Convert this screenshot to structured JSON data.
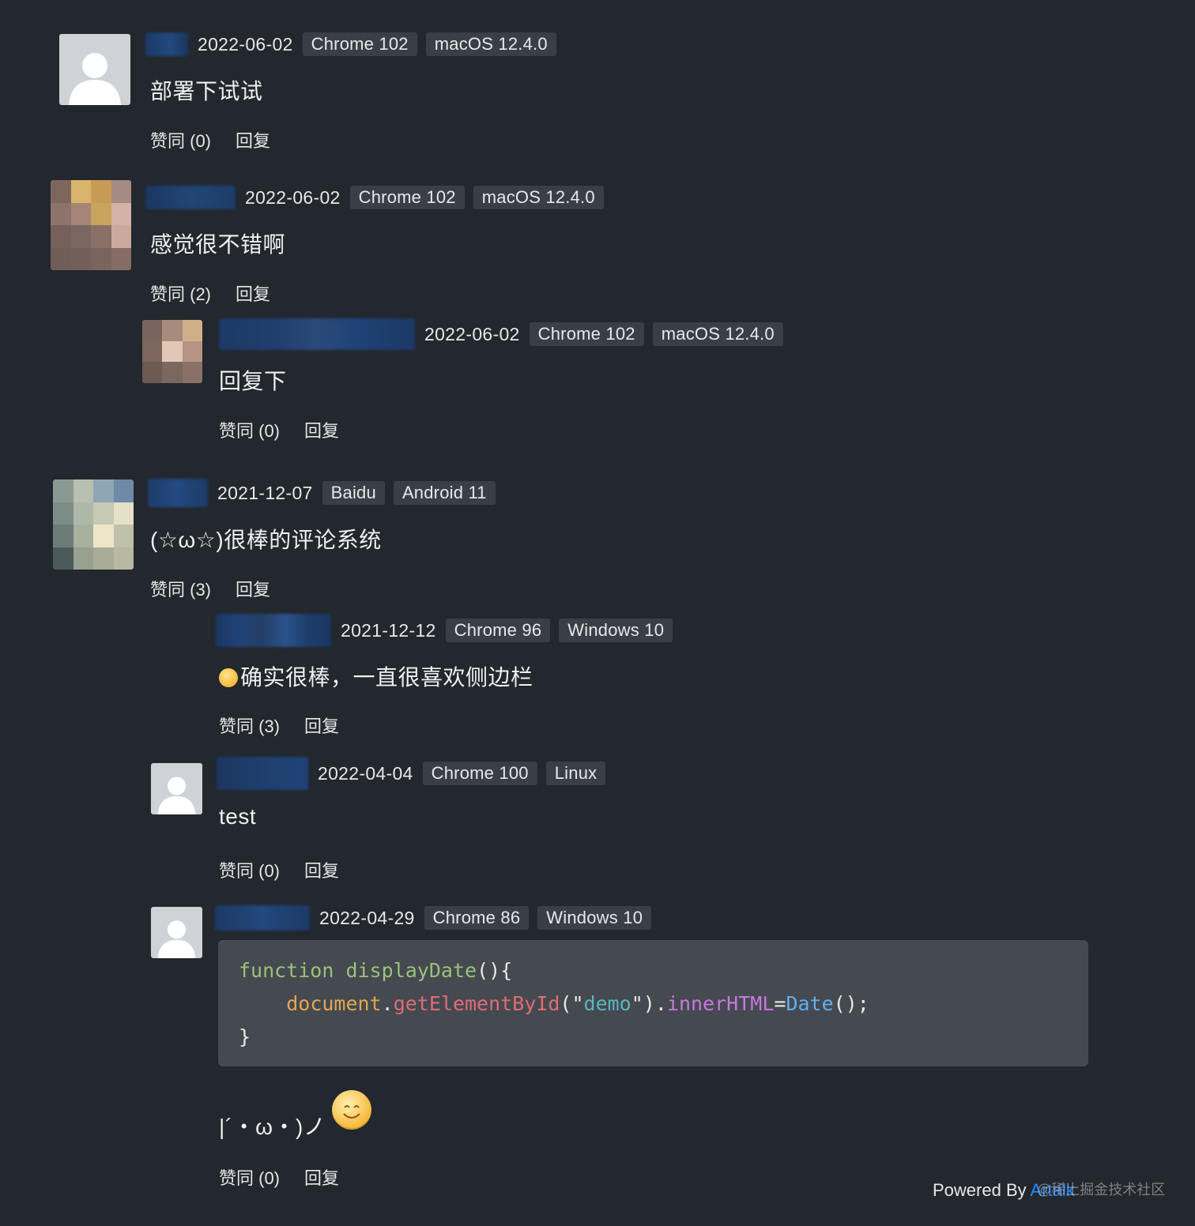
{
  "comments": [
    {
      "date": "2022-06-02",
      "browser": "Chrome 102",
      "os": "macOS 12.4.0",
      "content": "部署下试试",
      "like": "赞同 (0)",
      "reply": "回复"
    },
    {
      "date": "2022-06-02",
      "browser": "Chrome 102",
      "os": "macOS 12.4.0",
      "content": "感觉很不错啊",
      "like": "赞同 (2)",
      "reply": "回复"
    },
    {
      "date": "2022-06-02",
      "browser": "Chrome 102",
      "os": "macOS 12.4.0",
      "content": "回复下",
      "like": "赞同 (0)",
      "reply": "回复"
    },
    {
      "date": "2021-12-07",
      "browser": "Baidu",
      "os": "Android 11",
      "content": "(☆ω☆)很棒的评论系统",
      "like": "赞同 (3)",
      "reply": "回复"
    },
    {
      "date": "2021-12-12",
      "browser": "Chrome 96",
      "os": "Windows 10",
      "content": "确实很棒，一直很喜欢侧边栏",
      "like": "赞同 (3)",
      "reply": "回复"
    },
    {
      "date": "2022-04-04",
      "browser": "Chrome 100",
      "os": "Linux",
      "content": "test",
      "like": "赞同 (0)",
      "reply": "回复"
    },
    {
      "date": "2022-04-29",
      "browser": "Chrome 86",
      "os": "Windows 10",
      "content": "|´・ω・)ノ",
      "like": "赞同 (0)",
      "reply": "回复",
      "code": {
        "line1_kw": "function",
        "line1_fn": "displayDate",
        "line1_rest": "(){",
        "line2_indent": "    ",
        "line2_obj": "document",
        "line2_dot1": ".",
        "line2_method": "getElementById",
        "line2_open": "(\"",
        "line2_str": "demo",
        "line2_close": "\").",
        "line2_prop": "innerHTML",
        "line2_eq": "=",
        "line2_call": "Date",
        "line2_end": "();",
        "line3": "}"
      }
    }
  ],
  "footer": {
    "powered_by": "Powered By",
    "brand": "Artalk"
  },
  "watermark": "@稀土掘金技术社区",
  "icons": {
    "default_avatar": "user-silhouette-icon",
    "emoji": "smiley-emoji-icon"
  },
  "colors": {
    "background": "#23272e",
    "badge": "#3a3f47",
    "code_bg": "#454950",
    "brand": "#1e8cff"
  }
}
